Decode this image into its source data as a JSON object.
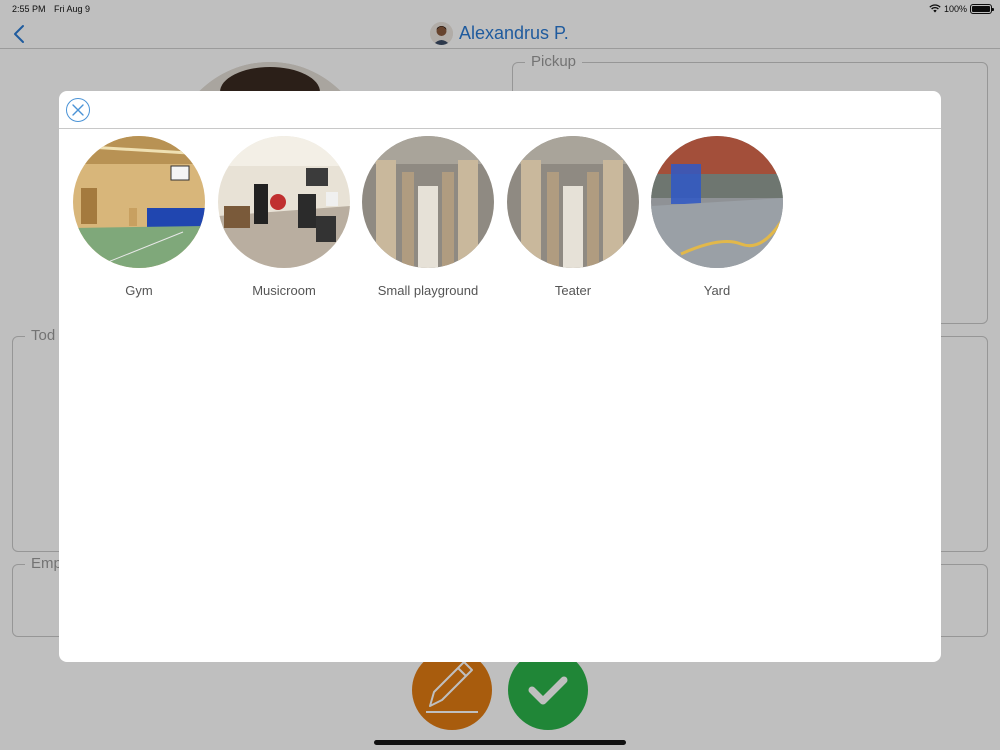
{
  "status_bar": {
    "time": "2:55 PM",
    "date": "Fri Aug 9",
    "battery": "100%"
  },
  "nav": {
    "title": "Alexandrus P.",
    "back_icon": "chevron-left-icon"
  },
  "background": {
    "sections": {
      "pickup": "Pickup",
      "today": "Tod",
      "emp": "Emp"
    }
  },
  "modal": {
    "close_icon": "close-circle-icon",
    "rooms": [
      {
        "label": "Gym"
      },
      {
        "label": "Musicroom"
      },
      {
        "label": "Small playground"
      },
      {
        "label": "Teater"
      },
      {
        "label": "Yard"
      }
    ]
  },
  "colors": {
    "accent": "#2a7ad3",
    "edit": "#e07b12",
    "confirm": "#2bb34a"
  }
}
